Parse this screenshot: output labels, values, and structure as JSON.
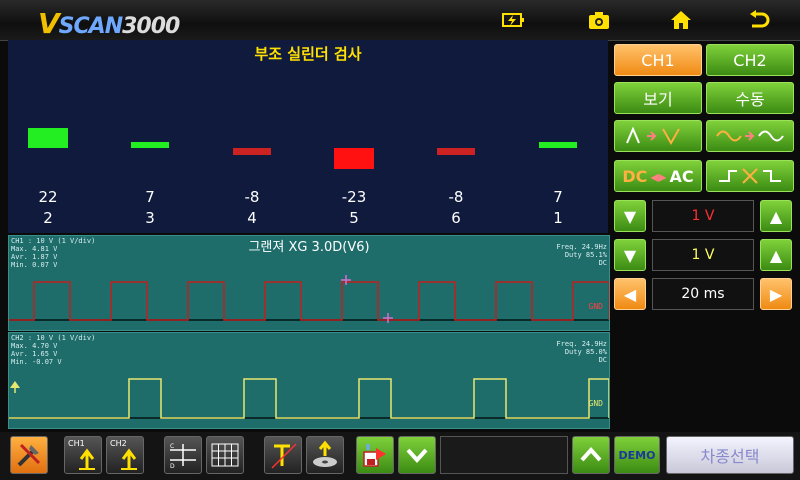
{
  "app": {
    "logo_v": "V",
    "logo_rest": "SCAN",
    "logo_num": "3000"
  },
  "topbar": {
    "icons": [
      "battery-charging-icon",
      "camera-icon",
      "home-icon",
      "back-icon"
    ]
  },
  "balance": {
    "title": "부조 실린더 검사",
    "values": [
      "22",
      "7",
      "-8",
      "-23",
      "-8",
      "7"
    ],
    "cylinders": [
      "2",
      "3",
      "4",
      "5",
      "6",
      "1"
    ],
    "colors": [
      "#22ee22",
      "#22ee22",
      "#cc2222",
      "#ff1111",
      "#cc2222",
      "#22ee22"
    ]
  },
  "scope": {
    "title": "그랜져 XG 3.0D(V6)",
    "ch1": {
      "stats": "CH1 : 10 V (1 V/div)\nMax. 4.81 V\nAvr. 1.87 V\nMin. 0.07 V",
      "freq": "Freq. 24.9Hz\nDuty 85.1%\nDC",
      "gnd": "GND",
      "color": "#c02020"
    },
    "ch2": {
      "stats": "CH2 : 10 V (1 V/div)\nMax. 4.70 V\nAvr. 1.65 V\nMin. -0.07 V",
      "freq": "Freq. 24.9Hz\nDuty 85.0%\nDC",
      "gnd": "GND",
      "color": "#e8e870"
    }
  },
  "controls": {
    "ch1": "CH1",
    "ch2": "CH2",
    "view": "보기",
    "manual": "수동",
    "dc_ac": "DC",
    "dc_ac2": "AC",
    "ch1_volt": "1 V",
    "ch2_volt": "1 V",
    "time": "20 ms"
  },
  "bottom": {
    "ch1_label": "CH1",
    "ch2_label": "CH2",
    "demo": "DEMO",
    "vehicle_select": "차종선택"
  }
}
